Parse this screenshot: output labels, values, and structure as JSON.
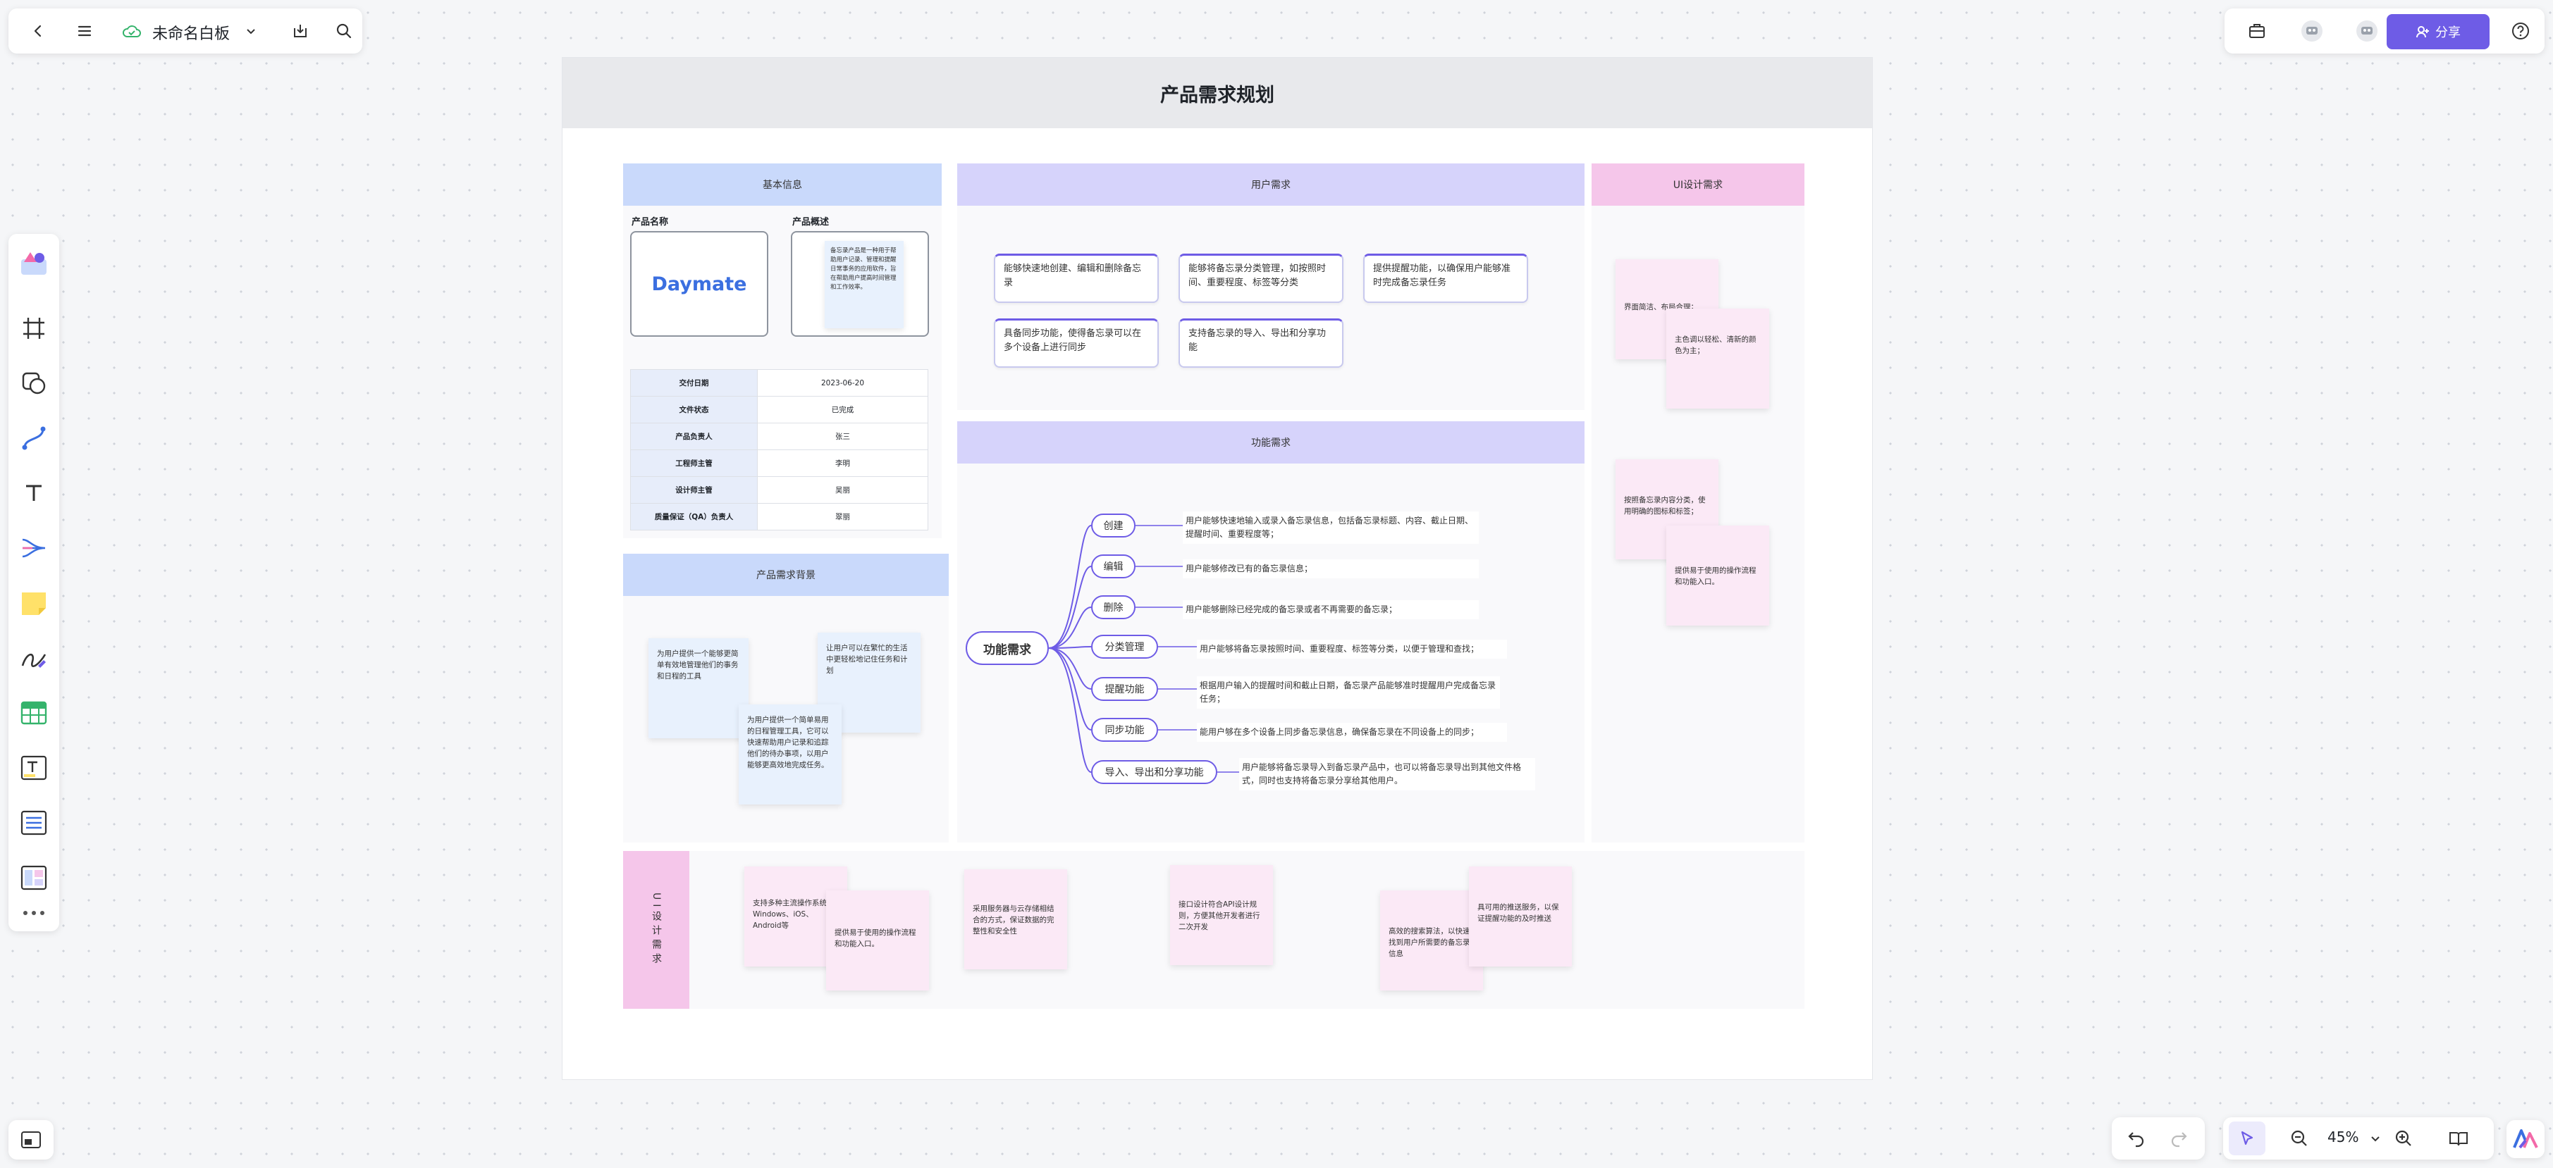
{
  "toolbar": {
    "title": "未命名白板",
    "share_label": "分享",
    "zoom": "45%"
  },
  "board": {
    "title": "产品需求规划",
    "basic": {
      "header": "基本信息",
      "name_label": "产品名称",
      "desc_label": "产品概述",
      "product_name": "Daymate",
      "product_desc": "备忘录产品是一种用于帮助用户记录、管理和提醒日常事务的应用软件，旨在帮助用户提高时间管理和工作效率。",
      "rows": [
        {
          "k": "交付日期",
          "v": "2023-06-20"
        },
        {
          "k": "文件状态",
          "v": "已完成"
        },
        {
          "k": "产品负责人",
          "v": "张三"
        },
        {
          "k": "工程师主管",
          "v": "李明"
        },
        {
          "k": "设计师主管",
          "v": "吴丽"
        },
        {
          "k": "质量保证（QA）负责人",
          "v": "翠丽"
        }
      ]
    },
    "background": {
      "header": "产品需求背景",
      "notes": [
        "为用户提供一个能够更简单有效地管理他们的事务和日程的工具",
        "让用户可以在繁忙的生活中更轻松地记住任务和计划",
        "为用户提供一个简单易用的日程管理工具，它可以快速帮助用户记录和追踪他们的待办事项，以用户能够更高效地完成任务。"
      ]
    },
    "user_req": {
      "header": "用户需求",
      "items": [
        "能够快速地创建、编辑和删除备忘录",
        "能够将备忘录分类管理，如按照时间、重要程度、标签等分类",
        "提供提醒功能，以确保用户能够准时完成备忘录任务",
        "具备同步功能，使得备忘录可以在多个设备上进行同步",
        "支持备忘录的导入、导出和分享功能"
      ]
    },
    "ui_req": {
      "header": "UI设计需求",
      "notes": [
        "界面简洁、布局合理；",
        "主色调以轻松、清新的颜色为主；",
        "按照备忘录内容分类，使用明确的图标和标签；",
        "提供易于使用的操作流程和功能入口。"
      ]
    },
    "func_req": {
      "header": "功能需求",
      "root": "功能需求",
      "branches": [
        {
          "name": "创建",
          "desc": "用户能够快速地输入或录入备忘录信息，包括备忘录标题、内容、截止日期、提醒时间、重要程度等；"
        },
        {
          "name": "编辑",
          "desc": "用户能够修改已有的备忘录信息；"
        },
        {
          "name": "删除",
          "desc": "用户能够删除已经完成的备忘录或者不再需要的备忘录；"
        },
        {
          "name": "分类管理",
          "desc": "用户能够将备忘录按照时间、重要程度、标签等分类，以便于管理和查找；"
        },
        {
          "name": "提醒功能",
          "desc": "根据用户输入的提醒时间和截止日期，备忘录产品能够准时提醒用户完成备忘录任务；"
        },
        {
          "name": "同步功能",
          "desc": "能用户够在多个设备上同步备忘录信息，确保备忘录在不同设备上的同步；"
        },
        {
          "name": "导入、导出和分享功能",
          "desc": "用户能够将备忘录导入到备忘录产品中，也可以将备忘录导出到其他文件格式，同时也支持将备忘录分享给其他用户。"
        }
      ]
    },
    "ui_bottom": {
      "label": "UI设计需求",
      "notes": [
        "支持多种主流操作系统，Windows、iOS、Android等",
        "提供易于使用的操作流程和功能入口。",
        "采用服务器与云存储相结合的方式，保证数据的完整性和安全性",
        "接口设计符合API设计规则，方便其他开发者进行二次开发",
        "高效的搜索算法，以快速找到用户所需要的备忘录信息",
        "具可用的推送服务，以保证提醒功能的及时推送"
      ]
    }
  },
  "colors": {
    "accent": "#6e5ce6",
    "blue_header": "#c9d9fb",
    "purple_header": "#d6d3fb",
    "pink_header": "#f5c6ea",
    "brand_blue": "#3b6fe0"
  }
}
